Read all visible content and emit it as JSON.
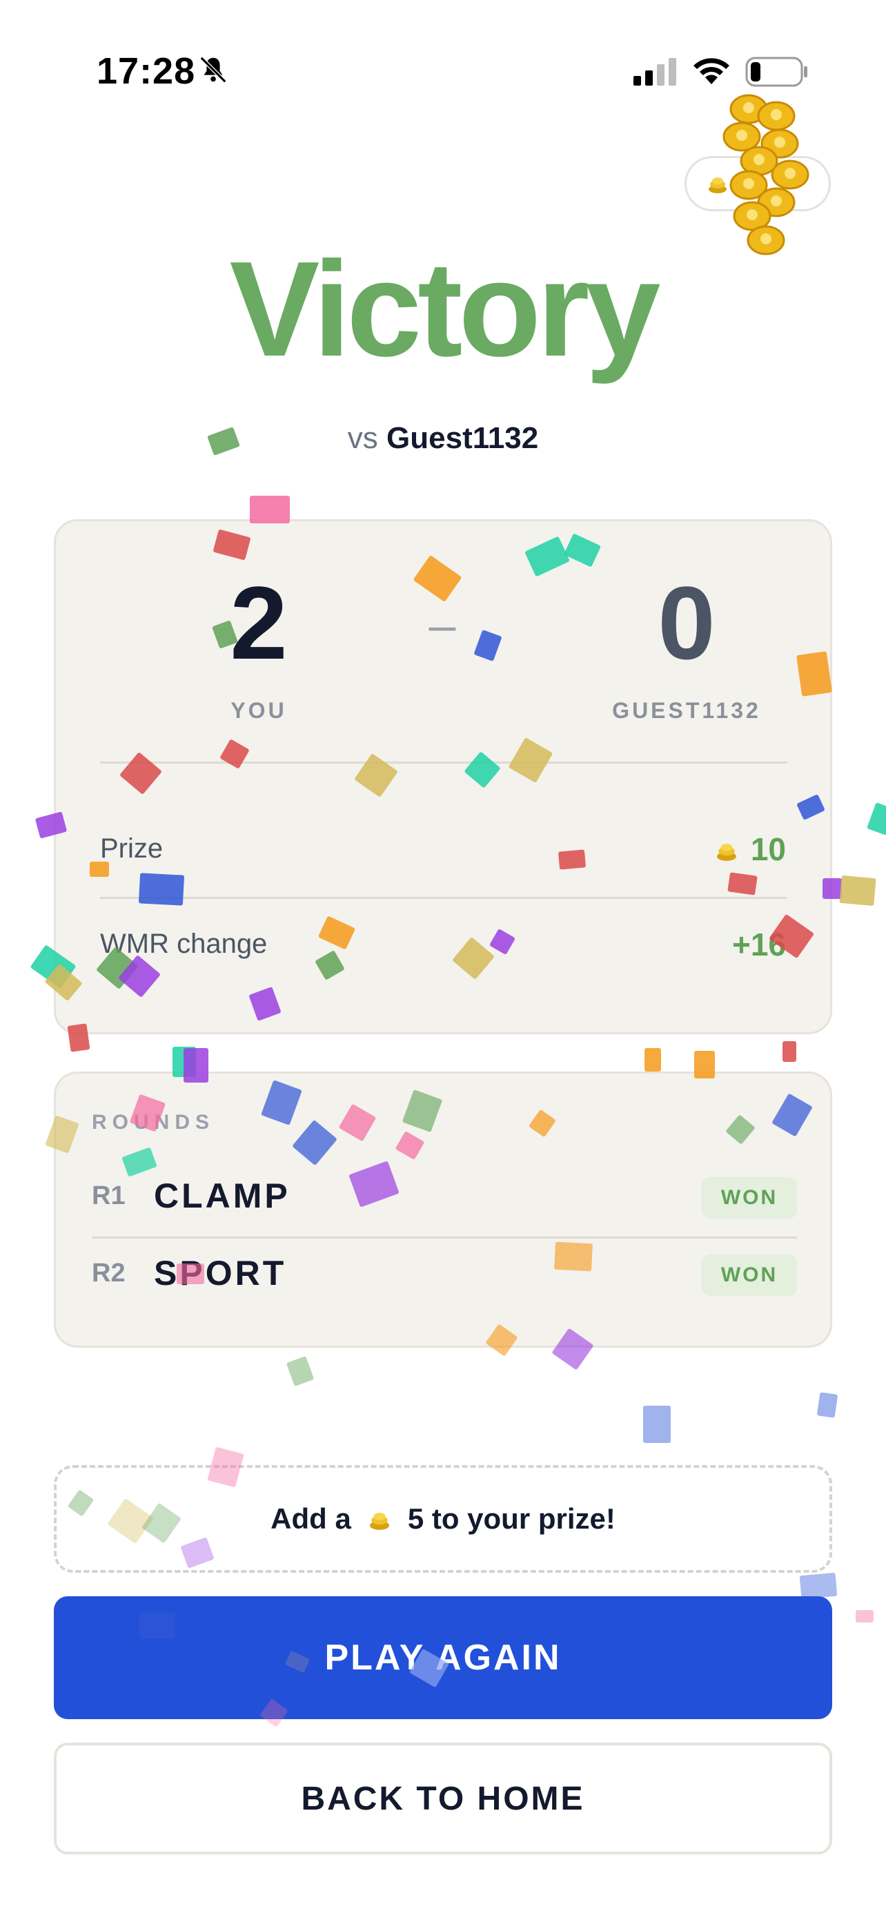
{
  "status": {
    "time": "17:28"
  },
  "result": {
    "title": "Victory",
    "vs_prefix": "vs",
    "opponent": "Guest1132"
  },
  "score": {
    "you": "2",
    "dash": "–",
    "opponent": "0",
    "you_label": "YOU",
    "opponent_label": "GUEST1132"
  },
  "stats": {
    "prize_label": "Prize",
    "prize_value": "10",
    "wmr_label": "WMR change",
    "wmr_value": "+16"
  },
  "rounds": {
    "title": "ROUNDS",
    "items": [
      {
        "id": "R1",
        "word": "CLAMP",
        "result": "WON"
      },
      {
        "id": "R2",
        "word": "SPORT",
        "result": "WON"
      }
    ]
  },
  "bonus": {
    "prefix": "Add a",
    "suffix": "5 to your prize!"
  },
  "buttons": {
    "play_again": "PLAY AGAIN",
    "back_home": "BACK TO HOME"
  },
  "colors": {
    "victory": "#6aaa62",
    "primary": "#2250d9",
    "card": "#f4f2ed",
    "won_badge": "#e4efdd"
  }
}
